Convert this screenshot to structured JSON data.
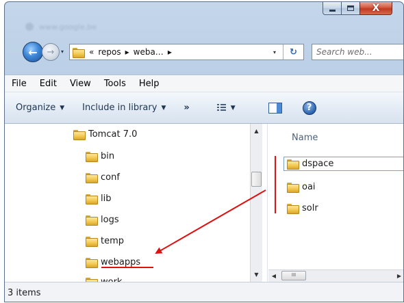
{
  "window": {
    "ghost_url": "www.google.be",
    "caption": {
      "minimize": "–",
      "maximize": "□",
      "close": "X"
    }
  },
  "nav": {
    "back_glyph": "←",
    "forward_glyph": "→",
    "address": {
      "overflow": "«",
      "crumbs": [
        "repos",
        "weba…"
      ],
      "separator": "▸",
      "dropdown": "▾",
      "refresh": "↻"
    },
    "search_placeholder": "Search web..."
  },
  "menubar": [
    "File",
    "Edit",
    "View",
    "Tools",
    "Help"
  ],
  "commandbar": {
    "organize": "Organize",
    "include": "Include in library",
    "more": "»",
    "caret": "▼",
    "help": "?"
  },
  "tree": [
    {
      "label": "Tomcat 7.0",
      "level": 0
    },
    {
      "label": "bin",
      "level": 1
    },
    {
      "label": "conf",
      "level": 1
    },
    {
      "label": "lib",
      "level": 1
    },
    {
      "label": "logs",
      "level": 1
    },
    {
      "label": "temp",
      "level": 1
    },
    {
      "label": "webapps",
      "level": 1
    },
    {
      "label": "work",
      "level": 1
    }
  ],
  "files": {
    "column_name": "Name",
    "items": [
      "dspace",
      "oai",
      "solr"
    ]
  },
  "scrollbar": {
    "up": "▲",
    "down": "▼",
    "left": "◀",
    "right": "▶",
    "thumb_grip": "III"
  },
  "status": {
    "text": "3 items"
  },
  "annotation": {
    "color": "#e01010"
  }
}
